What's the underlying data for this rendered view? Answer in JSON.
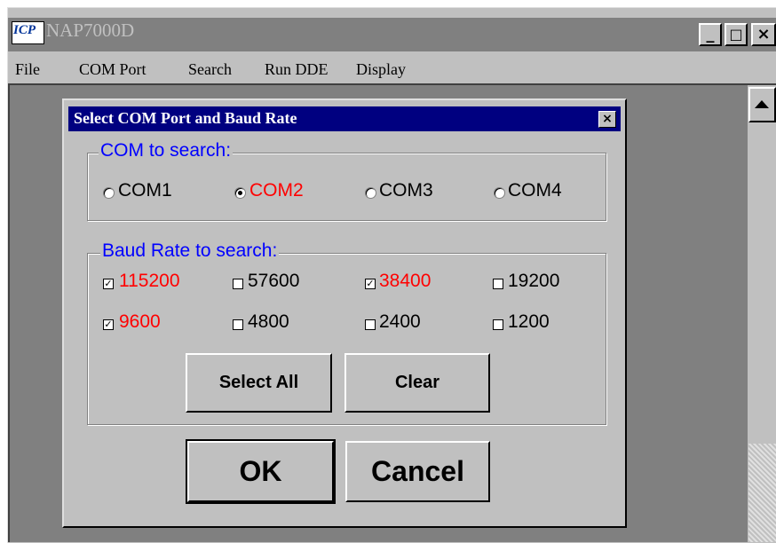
{
  "window": {
    "title": "NAP7000D",
    "logo_text": "ICP",
    "minimize": "_",
    "maximize": "□",
    "close": "×"
  },
  "menu": [
    "File",
    "COM Port",
    "Search",
    "Run DDE",
    "Display"
  ],
  "dialog": {
    "title": "Select COM Port and Baud Rate",
    "close": "×",
    "com_group": {
      "label": "COM to search:",
      "options": [
        {
          "label": "COM1",
          "selected": false
        },
        {
          "label": "COM2",
          "selected": true
        },
        {
          "label": "COM3",
          "selected": false
        },
        {
          "label": "COM4",
          "selected": false
        }
      ]
    },
    "baud_group": {
      "label": "Baud Rate to search:",
      "options": [
        {
          "label": "115200",
          "checked": true
        },
        {
          "label": "57600",
          "checked": false
        },
        {
          "label": "38400",
          "checked": true
        },
        {
          "label": "19200",
          "checked": false
        },
        {
          "label": "9600",
          "checked": true
        },
        {
          "label": "4800",
          "checked": false
        },
        {
          "label": "2400",
          "checked": false
        },
        {
          "label": "1200",
          "checked": false
        }
      ],
      "select_all": "Select  All",
      "clear": "Clear"
    },
    "ok": "OK",
    "cancel": "Cancel"
  },
  "colors": {
    "selected_text": "#ff0000",
    "group_label": "#0000ff",
    "dialog_title_bg": "#000080"
  }
}
